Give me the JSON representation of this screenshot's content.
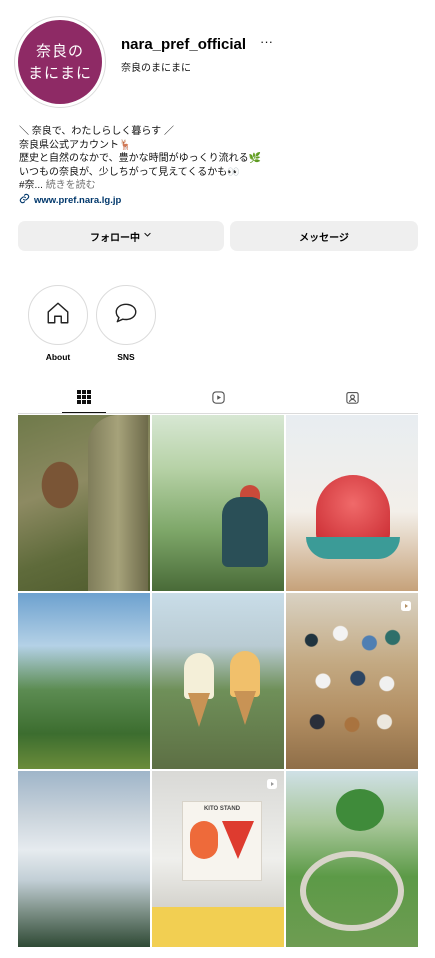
{
  "profile": {
    "avatar_line1": "奈良の",
    "avatar_line2": "まにまに",
    "username": "nara_pref_official",
    "more_label": "···",
    "display_name": "奈良のまにまに"
  },
  "bio": {
    "lines": [
      "＼ 奈良で、わたしらしく暮らす ／",
      "奈良県公式アカウント🦌",
      "歴史と自然のなかで、豊かな時間がゆっくり流れる🌿",
      "いつもの奈良が、少しちがって見えてくるかも👀"
    ],
    "last_line_prefix": "#奈...",
    "read_more": "続きを読む",
    "link": "www.pref.nara.lg.jp"
  },
  "buttons": {
    "follow": "フォロー中",
    "message": "メッセージ"
  },
  "highlights": [
    {
      "label": "About",
      "icon": "home-icon"
    },
    {
      "label": "SNS",
      "icon": "speech-bubble-icon"
    }
  ],
  "tabs": [
    {
      "icon": "grid-icon",
      "active": true
    },
    {
      "icon": "reels-icon",
      "active": false
    },
    {
      "icon": "tagged-icon",
      "active": false
    }
  ],
  "posts": [
    {
      "subject": "deer",
      "reel": false
    },
    {
      "subject": "tree-climber",
      "reel": false
    },
    {
      "subject": "shaved-ice",
      "reel": false
    },
    {
      "subject": "green-mountains",
      "reel": false
    },
    {
      "subject": "ice-cream-cones",
      "reel": false
    },
    {
      "subject": "group-photo",
      "reel": true
    },
    {
      "subject": "sea-of-clouds",
      "reel": false
    },
    {
      "subject": "cafe-interior",
      "reel": true
    },
    {
      "subject": "spiral-garden",
      "reel": false
    }
  ],
  "post8_sign": "KITO STAND",
  "colors": {
    "avatar_bg": "#8e2a65",
    "button_bg": "#efefef",
    "link": "#00376b",
    "muted": "#737373"
  }
}
